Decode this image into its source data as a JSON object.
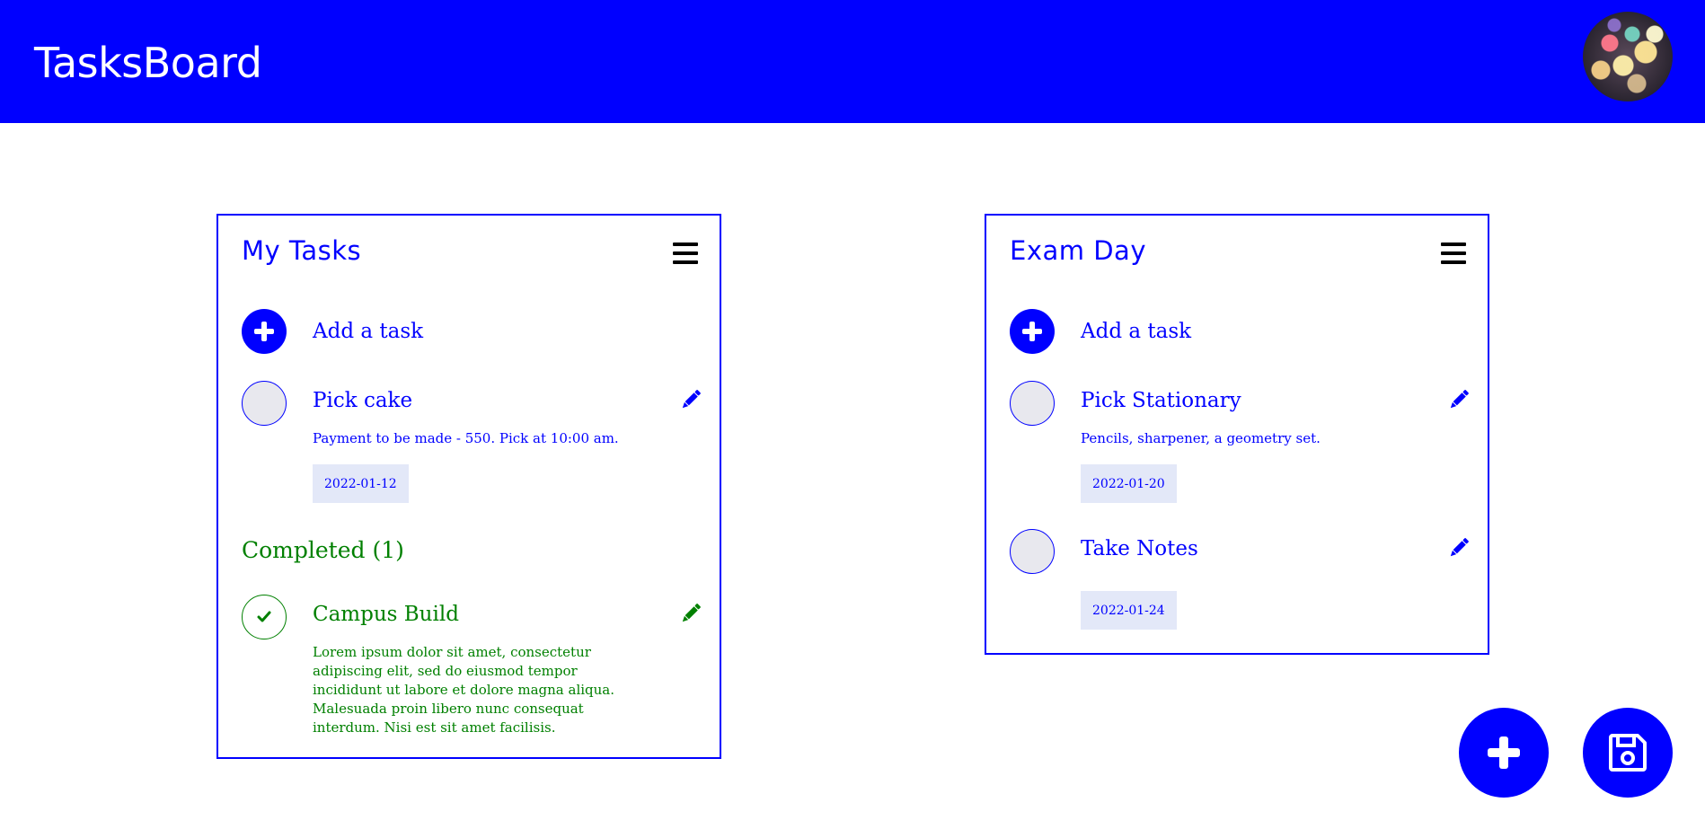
{
  "header": {
    "app_title": "TasksBoard"
  },
  "boards": [
    {
      "title": "My Tasks",
      "add_label": "Add a task",
      "tasks": [
        {
          "title": "Pick cake",
          "description": "Payment to be made - 550. Pick at 10:00 am.",
          "date": "2022-01-12"
        }
      ],
      "completed_heading": "Completed (1)",
      "completed": [
        {
          "title": "Campus Build",
          "description": "Lorem ipsum dolor sit amet, consectetur adipiscing elit, sed do eiusmod tempor incididunt ut labore et dolore magna aliqua. Malesuada proin libero nunc consequat interdum. Nisi est sit amet facilisis."
        }
      ]
    },
    {
      "title": "Exam Day",
      "add_label": "Add a task",
      "tasks": [
        {
          "title": "Pick Stationary",
          "description": "Pencils, sharpener, a geometry set.",
          "date": "2022-01-20"
        },
        {
          "title": "Take Notes",
          "date": "2022-01-24"
        }
      ]
    }
  ],
  "colors": {
    "primary": "#0000ff",
    "completed": "#008000",
    "date_tag_bg": "#e3e8f8"
  },
  "icons": [
    "hamburger-menu-icon",
    "plus-icon",
    "pencil-icon",
    "check-icon",
    "floppy-disk-icon"
  ]
}
